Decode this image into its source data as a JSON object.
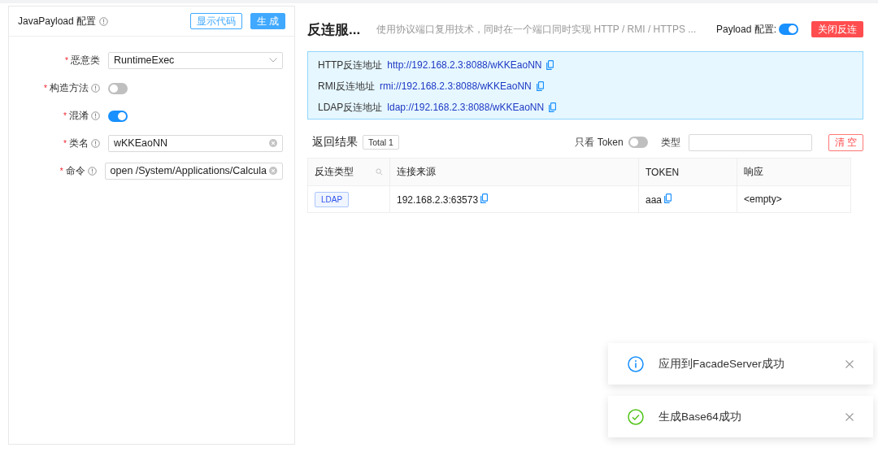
{
  "config_panel": {
    "title": "JavaPayload 配置",
    "buttons": [
      {
        "label": "显示代码",
        "kind": "outline"
      },
      {
        "label": "生 成",
        "kind": "primary"
      }
    ],
    "fields": [
      {
        "mark": "*",
        "label": "恶意类",
        "info": false,
        "kind": "select",
        "value": "RuntimeExec"
      },
      {
        "mark": "*",
        "label": "构造方法",
        "info": true,
        "kind": "switch",
        "on": false
      },
      {
        "mark": "*",
        "label": "混淆",
        "info": true,
        "kind": "switch",
        "on": true
      },
      {
        "mark": "*",
        "label": "类名",
        "info": true,
        "kind": "input",
        "value": "wKKEaoNN"
      },
      {
        "mark": "*",
        "label": "命令",
        "info": true,
        "kind": "input",
        "value": "open /System/Applications/Calcula"
      }
    ]
  },
  "server": {
    "title": "反连服...",
    "description": "使用协议端口复用技术，同时在一个端口同时实现 HTTP / RMI / HTTPS ...",
    "payload_config": {
      "label": "Payload 配置:",
      "on": true
    },
    "close_button": "关闭反连",
    "addresses": [
      {
        "label": "HTTP反连地址",
        "url": "http://192.168.2.3:8088/wKKEaoNN"
      },
      {
        "label": "RMI反连地址",
        "url": "rmi://192.168.2.3:8088/wKKEaoNN"
      },
      {
        "label": "LDAP反连地址",
        "url": "ldap://192.168.2.3:8088/wKKEaoNN"
      }
    ]
  },
  "results": {
    "title": "返回结果",
    "total": "Total 1",
    "token_only": {
      "label": "只看 Token",
      "on": false
    },
    "type_filter": {
      "label": "类型"
    },
    "clear_button": "清 空",
    "table": {
      "columns": [
        "反连类型",
        "连接来源",
        "TOKEN",
        "响应"
      ],
      "rows": [
        {
          "type": "LDAP",
          "source": "192.168.2.3:63573",
          "token": "aaa",
          "response": "<empty>"
        }
      ]
    }
  },
  "notifications": [
    {
      "kind": "info",
      "message": "应用到FacadeServer成功"
    },
    {
      "kind": "success",
      "message": "生成Base64成功"
    }
  ]
}
